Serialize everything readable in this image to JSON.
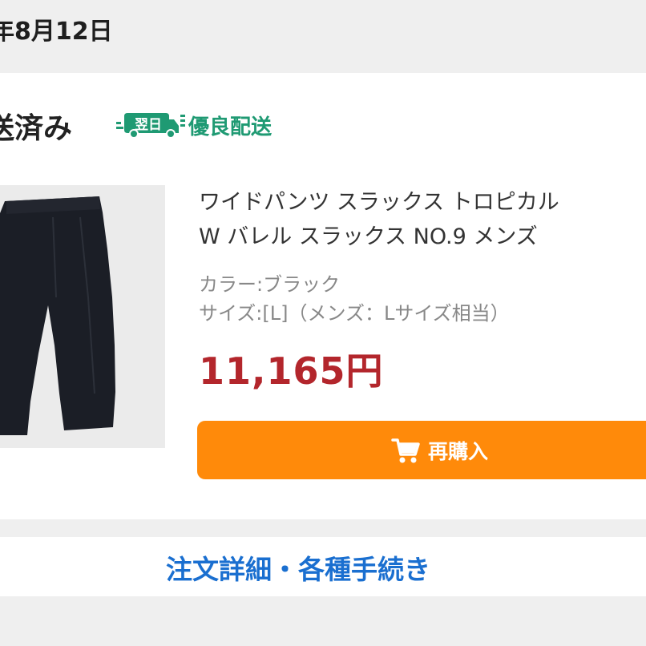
{
  "date": "年8月12日",
  "order": {
    "status": "送済み",
    "badge_tag": "翌日",
    "badge_label": "優良配送"
  },
  "product": {
    "title_line1": "ワイドパンツ スラックス トロピカル",
    "title_line2": "W バレル スラックス NO.9 メンズ",
    "color": "カラー:ブラック",
    "size": "サイズ:[L]（メンズ：Lサイズ相当）",
    "price": "11,165円",
    "image_icon": "pants-image"
  },
  "actions": {
    "rebuy_label": "再購入",
    "rebuy_icon": "cart-icon",
    "detail_link": "注文詳細・各種手続き"
  },
  "colors": {
    "accent": "#ff8a0a",
    "price": "#b3262c",
    "link": "#1a6fd0",
    "ship_badge": "#1f9a73"
  }
}
